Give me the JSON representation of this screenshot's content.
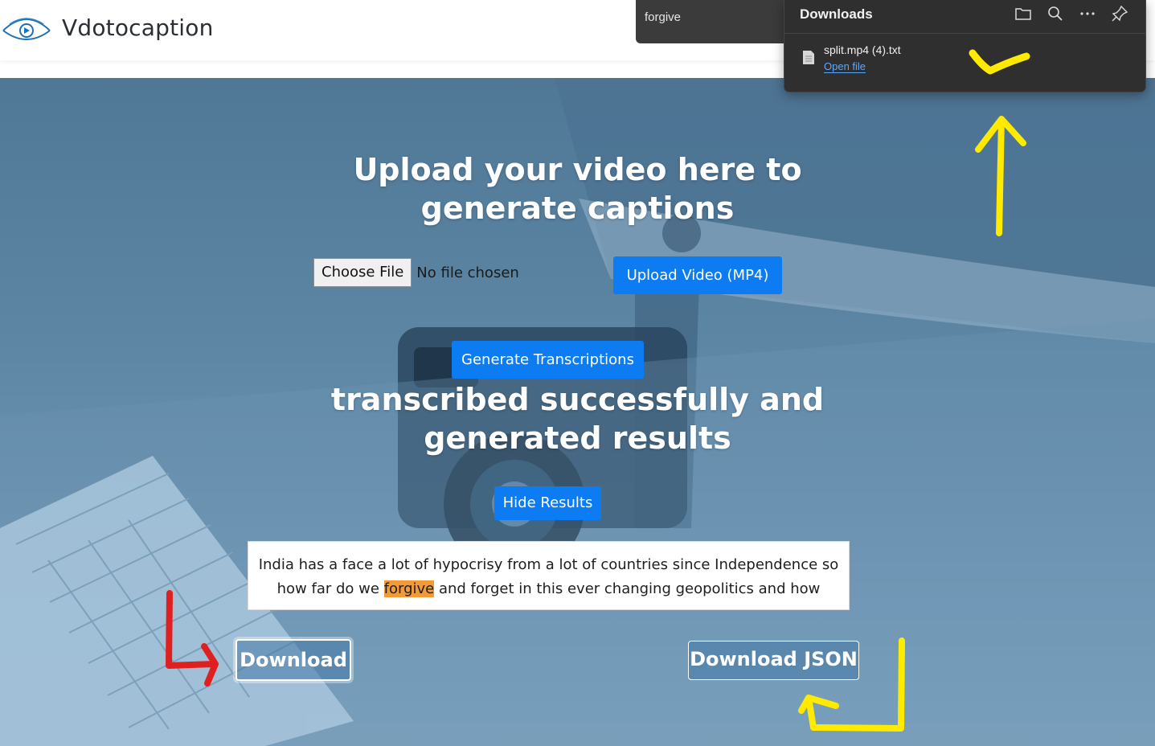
{
  "header": {
    "brand": "Vdotocaption",
    "logo_icon": "eye-play-logo-icon"
  },
  "find_bar": {
    "query": "forgive"
  },
  "downloads_panel": {
    "title": "Downloads",
    "toolbar_icons": [
      "folder-icon",
      "search-icon",
      "more-icon",
      "pin-icon"
    ],
    "items": [
      {
        "file_name": "split.mp4 (4).txt",
        "action_label": "Open file",
        "icon": "file-icon"
      }
    ]
  },
  "main": {
    "headline": "Upload your video here to generate captions",
    "choose_file_label": "Choose File",
    "no_file_text": "No file chosen",
    "upload_button": "Upload Video (MP4)",
    "generate_button": "Generate Transcriptions",
    "status_headline": "transcribed successfully and generated results",
    "hide_results_button": "Hide Results",
    "transcript": {
      "before": "India has a face a lot of hypocrisy from a lot of countries since Independence so how far do we ",
      "highlight": "forgive",
      "after": " and forget in this ever changing geopolitics and how"
    },
    "download_button": "Download",
    "download_json_button": "Download JSON"
  },
  "colors": {
    "primary_button": "#0d7cf2",
    "highlight": "#f29a3a",
    "annotation_yellow": "#ffea00",
    "annotation_red": "#e02020",
    "panel_bg": "#2f2f2f"
  }
}
